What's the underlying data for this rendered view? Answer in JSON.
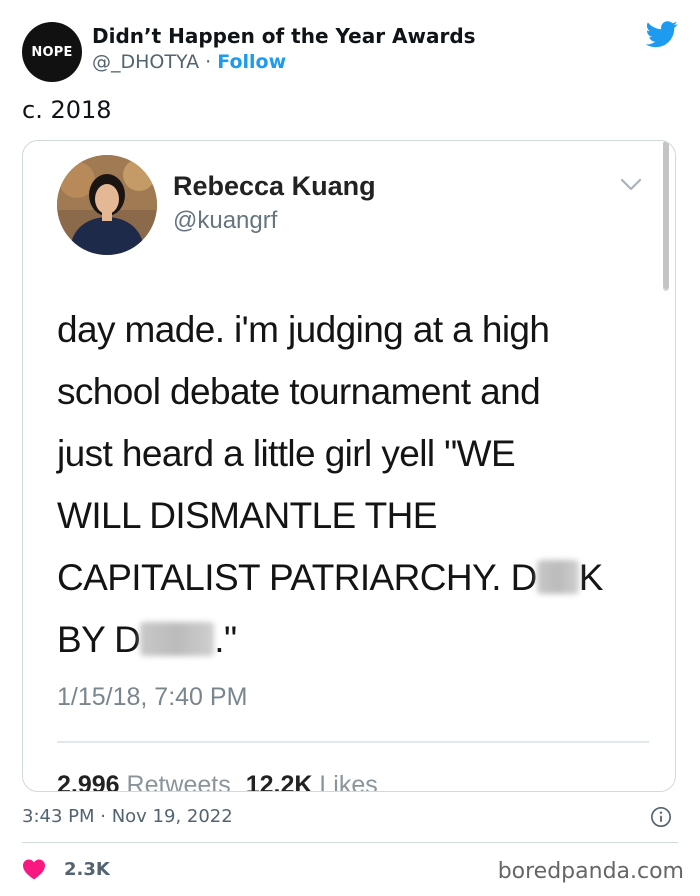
{
  "header": {
    "avatar_text": "NOPE",
    "display_name": "Didn’t Happen of the Year Awards",
    "handle": "@_DHOTYA",
    "separator": " · ",
    "follow_label": "Follow"
  },
  "tweet": {
    "text": "c. 2018",
    "time": "3:43 PM · Nov 19, 2022",
    "like_count": "2.3K"
  },
  "embedded_tweet": {
    "name": "Rebecca Kuang",
    "handle": "@kuangrf",
    "body_lines": [
      "day made. i'm judging at a high",
      "school debate tournament and",
      "just heard a little girl yell \"WE",
      "WILL DISMANTLE THE",
      "CAPITALIST PATRIARCHY. D",
      "K",
      "BY D",
      ".\""
    ],
    "timestamp": "1/15/18, 7:40 PM",
    "retweets_count": "2,996",
    "retweets_label": "Retweets",
    "likes_count": "12.2K",
    "likes_label": "Likes"
  },
  "watermark": "boredpanda.com",
  "colors": {
    "accent": "#1d9bf0",
    "heart": "#f91880",
    "muted": "#536471"
  },
  "icons": [
    "twitter-bird-icon",
    "chevron-down-icon",
    "info-icon",
    "heart-icon"
  ]
}
